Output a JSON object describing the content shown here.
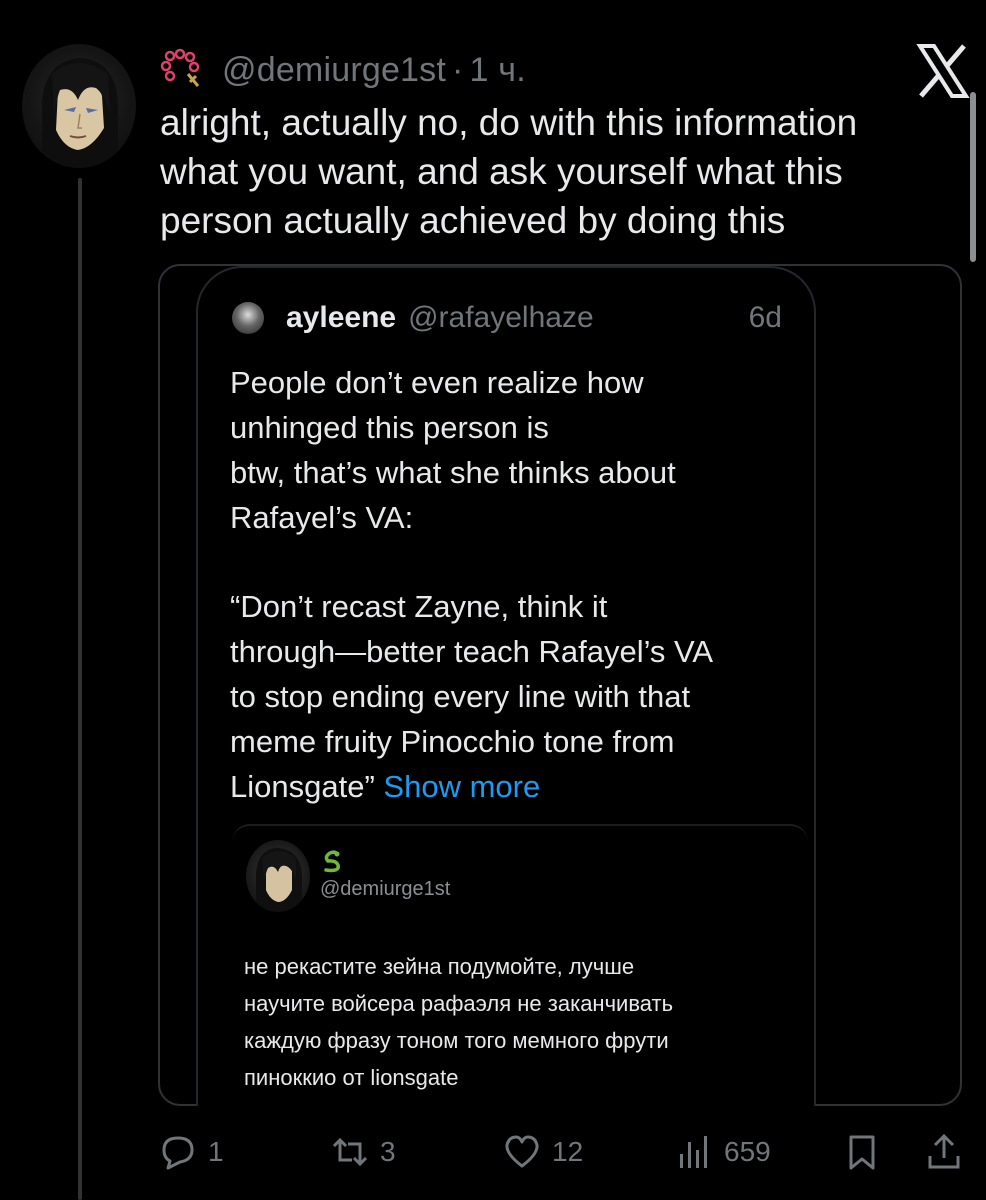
{
  "author": {
    "handle": "@demiurge1st",
    "separator": "·",
    "time": "1 ч.",
    "avatar_icon": "avatar-icon",
    "emoji_icon": "rosary-emoji-icon"
  },
  "tweet": {
    "lines": [
      "alright, actually no, do with this information",
      "what you want, and ask yourself what this",
      "person actually achieved by doing this"
    ]
  },
  "quote": {
    "name": "ayleene",
    "handle": "@rafayelhaze",
    "time": "6d",
    "lines_a": [
      "People don’t even realize how",
      "unhinged this person is",
      "btw, that’s what she thinks about",
      "Rafayel’s VA:"
    ],
    "lines_b": [
      "“Don’t recast Zayne, think it",
      "through—better teach Rafayel’s VA",
      "to stop ending every line with that",
      "meme fruity Pinocchio tone from"
    ],
    "last_line": "Lionsgate”",
    "show_more": "Show more"
  },
  "embedded_screenshot": {
    "handle": "@demiurge1st",
    "snake_icon": "snake-emoji-icon",
    "lines": [
      "не рекастите зейна подумойте, лучше",
      "научите войсера рафаэля не заканчивать",
      "каждую фразу тоном того мемного фрути",
      "пинοккио от lionsgate"
    ]
  },
  "actions": {
    "replies": "1",
    "reposts": "3",
    "likes": "12",
    "views": "659"
  },
  "colors": {
    "background": "#000000",
    "text": "#e7e9ea",
    "muted": "#71767b",
    "link": "#1d9bf0",
    "border": "#2f3336"
  }
}
